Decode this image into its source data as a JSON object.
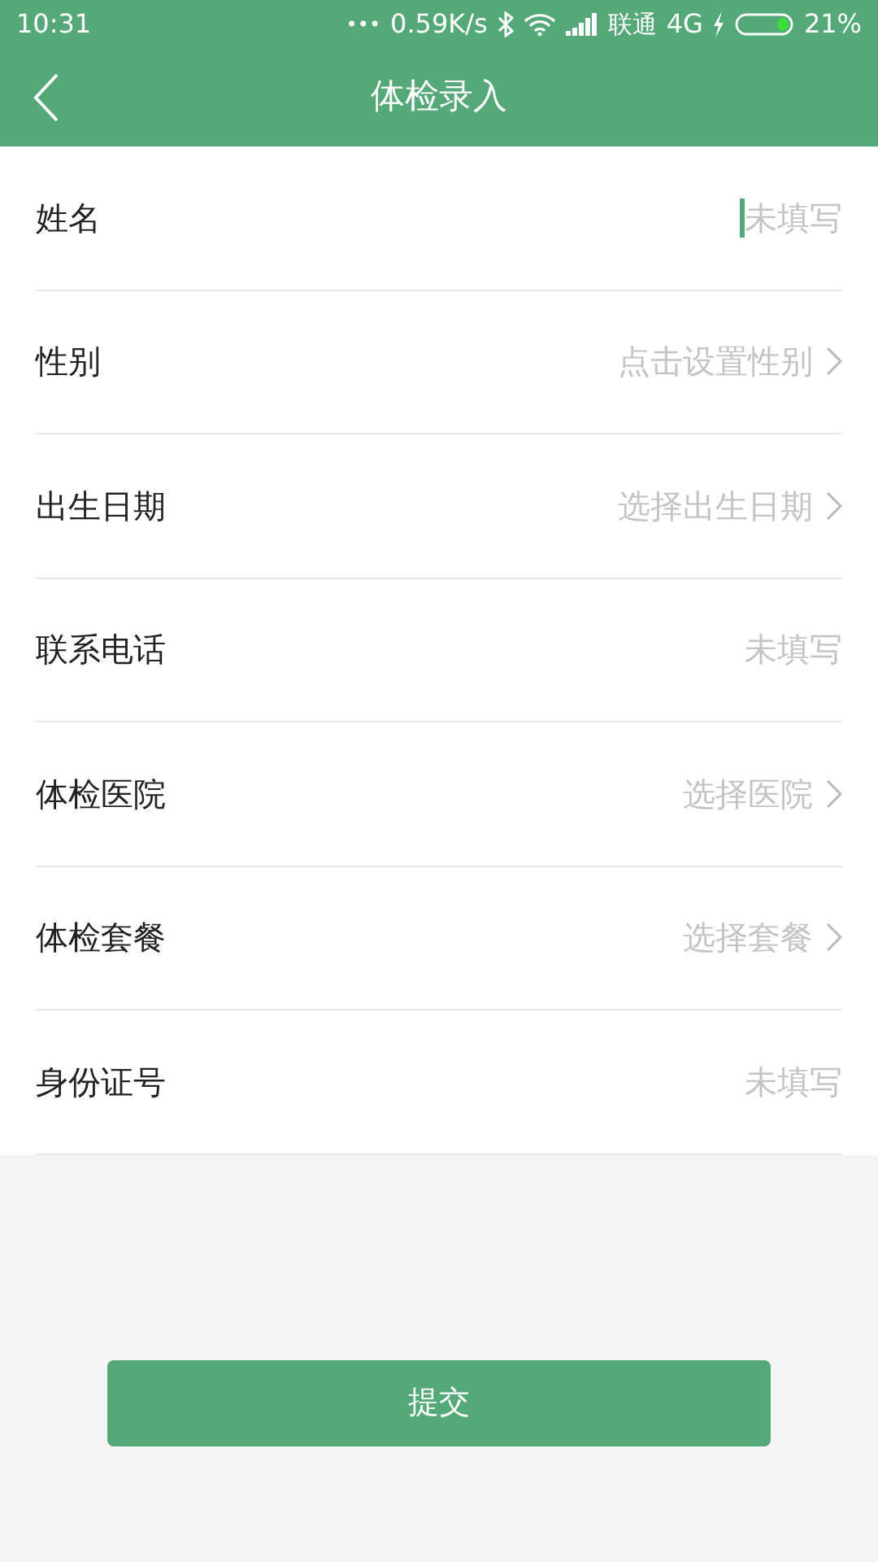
{
  "status_bar": {
    "time": "10:31",
    "dots": "•••",
    "speed": "0.59K/s",
    "carrier": "联通",
    "network": "4G",
    "battery": "21%"
  },
  "header": {
    "title": "体检录入"
  },
  "form": [
    {
      "kind": "input",
      "label": "姓名",
      "placeholder": "未填写",
      "focused": true
    },
    {
      "kind": "select",
      "label": "性别",
      "placeholder": "点击设置性别"
    },
    {
      "kind": "select",
      "label": "出生日期",
      "placeholder": "选择出生日期"
    },
    {
      "kind": "input",
      "label": "联系电话",
      "placeholder": "未填写",
      "focused": false
    },
    {
      "kind": "select",
      "label": "体检医院",
      "placeholder": "选择医院"
    },
    {
      "kind": "select",
      "label": "体检套餐",
      "placeholder": "选择套餐"
    },
    {
      "kind": "input",
      "label": "身份证号",
      "placeholder": "未填写",
      "focused": false
    }
  ],
  "submit": "提交"
}
